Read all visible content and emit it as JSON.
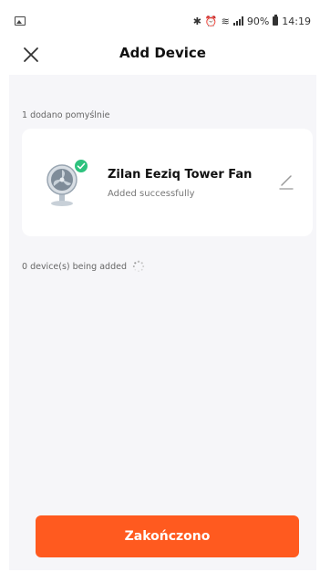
{
  "status_bar": {
    "battery_percent": "90%",
    "time": "14:19",
    "icons": [
      "gallery-icon",
      "bluetooth-icon",
      "alarm-icon",
      "wifi-icon",
      "signal-icon",
      "battery-icon"
    ]
  },
  "header": {
    "title": "Add Device",
    "close_icon": "close-icon"
  },
  "added_section": {
    "label": "1 dodano pomyślnie"
  },
  "device": {
    "name": "Zilan Eeziq Tower Fan",
    "status": "Added successfully",
    "icon": "fan-icon",
    "badge_icon": "check-icon",
    "edit_icon": "edit-icon"
  },
  "adding_section": {
    "label": "0 device(s) being added",
    "spinner_icon": "loading-spinner-icon"
  },
  "footer": {
    "finish_label": "Zakończono",
    "button_color": "#ff5a1f"
  },
  "colors": {
    "accent": "#ff5a1f",
    "success": "#2ec27e",
    "background": "#f6f6f9"
  }
}
